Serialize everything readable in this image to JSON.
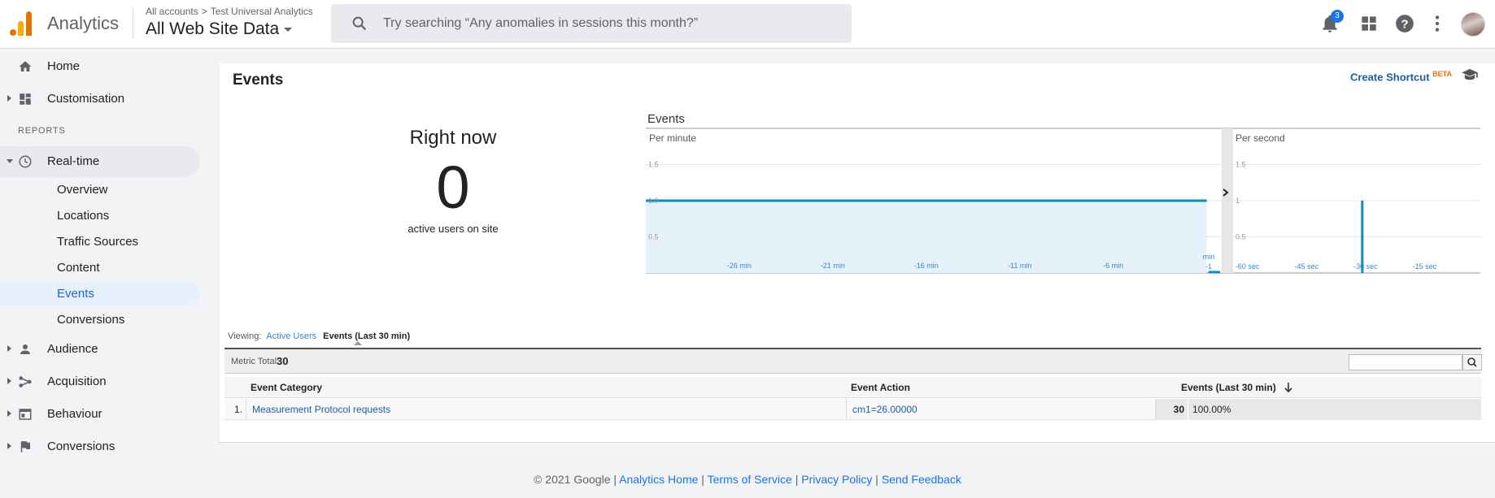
{
  "header": {
    "app_name": "Analytics",
    "breadcrumb_accounts": "All accounts",
    "breadcrumb_chevron": ">",
    "breadcrumb_property": "Test Universal Analytics",
    "view_name": "All Web Site Data",
    "search_placeholder": "Try searching “Any anomalies in sessions this month?”",
    "notifications_count": "3"
  },
  "sidebar": {
    "home": "Home",
    "customisation": "Customisation",
    "reports_label": "REPORTS",
    "realtime": "Real-time",
    "realtime_sub": [
      "Overview",
      "Locations",
      "Traffic Sources",
      "Content",
      "Events",
      "Conversions"
    ],
    "selected_sub": "Events",
    "audience": "Audience",
    "acquisition": "Acquisition",
    "behaviour": "Behaviour",
    "conversions": "Conversions"
  },
  "main": {
    "title": "Events",
    "create_shortcut": "Create Shortcut",
    "beta": "BETA",
    "right_now_title": "Right now",
    "right_now_value": "0",
    "right_now_sub": "active users on site",
    "chart_heading": "Events",
    "per_minute_label": "Per minute",
    "per_second_label": "Per second",
    "viewing_label": "Viewing:",
    "tab_active_users": "Active Users",
    "tab_events": "Events (Last 30 min)",
    "metric_total_label": "Metric Total:",
    "metric_total_value": "30",
    "table": {
      "headers": [
        "Event Category",
        "Event Action",
        "Events (Last 30 min)"
      ],
      "rows": [
        {
          "index": "1.",
          "category": "Measurement Protocol requests",
          "action": "cm1=26.00000",
          "events": "30",
          "percent": "100.00%"
        }
      ]
    }
  },
  "chart_data": [
    {
      "type": "area",
      "title": "Per minute",
      "x_tick_labels": [
        "-26 min",
        "-21 min",
        "-16 min",
        "-11 min",
        "-6 min",
        "-1"
      ],
      "x_unit_label": "min",
      "y_tick_labels": [
        "0.5",
        "1.0",
        "1.5"
      ],
      "ylim": [
        0,
        2
      ],
      "x": [
        -29,
        -1
      ],
      "values": [
        1,
        1
      ],
      "grid": true,
      "color": "#058dc7"
    },
    {
      "type": "bar",
      "title": "Per second",
      "x_tick_labels": [
        "-60 sec",
        "-45 sec",
        "-30 sec",
        "-15 sec"
      ],
      "y_tick_labels": [
        "0.5",
        "1",
        "1.5"
      ],
      "ylim": [
        0,
        2
      ],
      "x": [
        -30
      ],
      "values": [
        1
      ],
      "grid": true,
      "color": "#058dc7"
    }
  ],
  "footer": {
    "copyright": "© 2021 Google",
    "separator": " | ",
    "links": [
      "Analytics Home",
      "Terms of Service",
      "Privacy Policy",
      "Send Feedback"
    ]
  },
  "colors": {
    "accent": "#1a73e8",
    "chart_blue": "#058dc7",
    "chart_fill": "#e5f2f9",
    "logo_orange": "#e37400",
    "logo_yellow": "#f9ab00"
  },
  "icons": [
    "search-icon",
    "bell-icon",
    "apps-icon",
    "help-icon",
    "more-icon",
    "home-icon",
    "dashboard-icon",
    "clock-icon",
    "person-icon",
    "acquisition-icon",
    "behaviour-icon",
    "flag-icon",
    "mortarboard-icon",
    "chevron-right-icon",
    "sort-down-icon"
  ]
}
